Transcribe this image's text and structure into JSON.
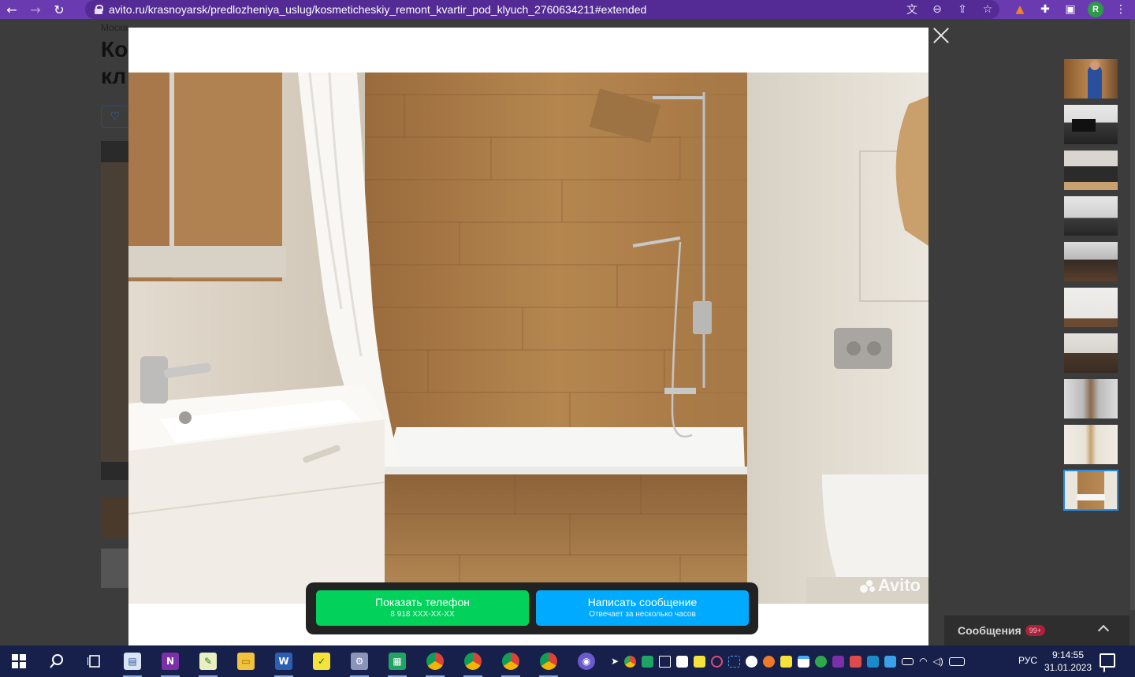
{
  "browser": {
    "url": "avito.ru/krasnoyarsk/predlozheniya_uslug/kosmeticheskiy_remont_kvartir_pod_klyuch_2760634211#extended",
    "avatar_letter": "R",
    "accent": "#6a3bb0"
  },
  "background_page": {
    "breadcrumbs": "Москв",
    "title_fragment_1": "Ко",
    "title_fragment_2": "кл"
  },
  "gallery": {
    "watermark": "Avito",
    "thumbnail_count": 10,
    "active_thumbnail": 10
  },
  "cta": {
    "phone_label": "Показать телефон",
    "phone_number": "8 918 XXX-XX-XX",
    "message_label": "Написать сообщение",
    "message_sub": "Отвечает за несколько часов",
    "phone_color": "#02d15c",
    "message_color": "#00aaff"
  },
  "messages_widget": {
    "label": "Сообщения",
    "badge": "99+"
  },
  "taskbar": {
    "language": "РУС",
    "time": "9:14:55",
    "date": "31.01.2023"
  }
}
